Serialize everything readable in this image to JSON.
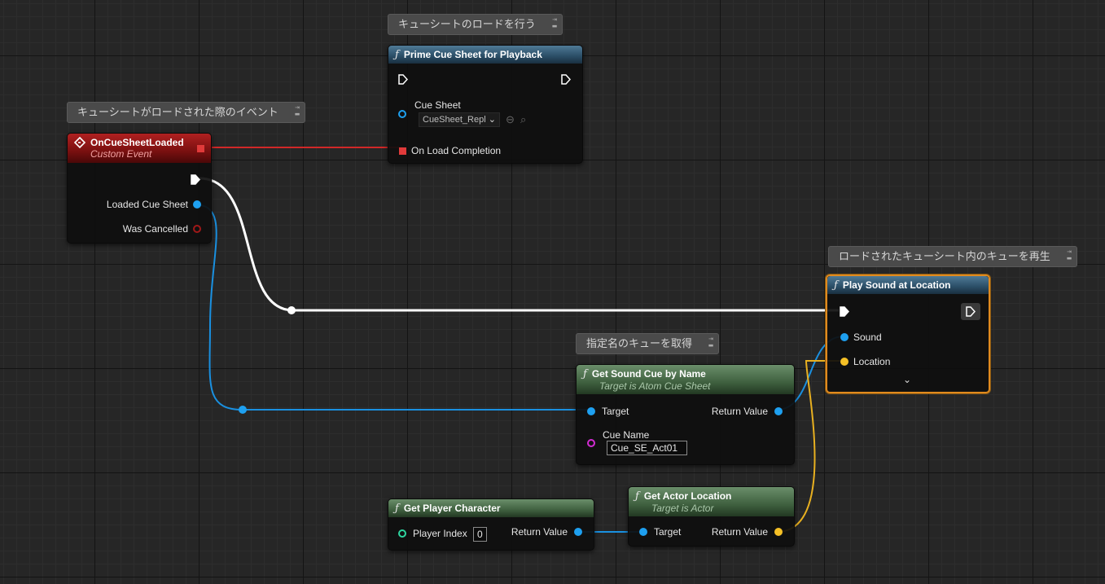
{
  "comments": {
    "prime": "キューシートのロードを行う",
    "event": "キューシートがロードされた際のイベント",
    "play": "ロードされたキューシート内のキューを再生",
    "getcue": "指定名のキューを取得"
  },
  "icons": {
    "function": "ƒ",
    "collapse": "⇥"
  },
  "nodes": {
    "prime": {
      "title": "Prime Cue Sheet for Playback",
      "cue_sheet_label": "Cue Sheet",
      "cue_sheet_value": "CueSheet_Repl",
      "on_load_label": "On Load Completion"
    },
    "event": {
      "title": "OnCueSheetLoaded",
      "subtitle": "Custom Event",
      "loaded_label": "Loaded Cue Sheet",
      "cancelled_label": "Was Cancelled"
    },
    "play": {
      "title": "Play Sound at Location",
      "sound_label": "Sound",
      "location_label": "Location"
    },
    "getcue": {
      "title": "Get Sound Cue by Name",
      "subtitle": "Target is Atom Cue Sheet",
      "target_label": "Target",
      "return_label": "Return Value",
      "cue_name_label": "Cue Name",
      "cue_name_value": "Cue_SE_Act01"
    },
    "player": {
      "title": "Get Player Character",
      "index_label": "Player Index",
      "index_value": "0",
      "return_label": "Return Value"
    },
    "actorloc": {
      "title": "Get Actor Location",
      "subtitle": "Target is Actor",
      "target_label": "Target",
      "return_label": "Return Value"
    }
  },
  "colors": {
    "exec_wire": "#ffffff",
    "object_pin": "#1ea0f0",
    "vector_pin": "#f5c026",
    "delegate_pin": "#e03a3a",
    "name_pin": "#d22cd2",
    "int_pin": "#2ed6a0",
    "selection_border": "#e08a1e"
  }
}
